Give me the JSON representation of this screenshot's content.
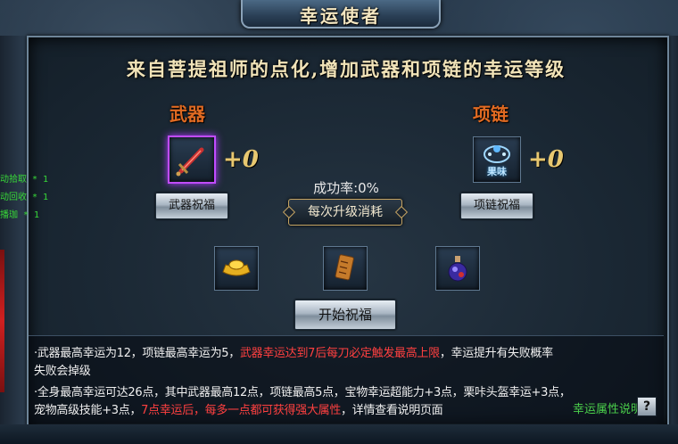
{
  "window": {
    "title": "幸运使者"
  },
  "headline": "来自菩提祖师的点化,增加武器和项链的幸运等级",
  "weapon": {
    "title": "武器",
    "level": "+0",
    "button": "武器祝福"
  },
  "necklace": {
    "title": "项链",
    "level": "+0",
    "button": "项链祝福",
    "icon_text": "果味"
  },
  "success_rate": "成功率:0%",
  "consume_label": "每次升级消耗",
  "start_button": "开始祝福",
  "side_log": [
    {
      "text": "动拾取 * 1"
    },
    {
      "text": "动回收 * 1"
    },
    {
      "text": "播珈 * 1"
    }
  ],
  "info": {
    "line1_a": "·武器最高幸运为12，项链最高幸运为5，",
    "line1_b": "武器幸运达到7后每刀必定触发最高上限",
    "line1_c": "，幸运提升有失败概率",
    "line2": "失败会掉级",
    "line3": "·全身最高幸运可达26点，其中武器最高12点，项链最高5点，宝物幸运超能力+3点，栗咔头盔幸运+3点，",
    "line4_a": "宠物高级技能+3点，",
    "line4_b": "7点幸运后，每多一点都可获得强大属性",
    "line4_c": "，详情查看说明页面",
    "link": "幸运属性说明",
    "help": "?"
  },
  "colors": {
    "accent_red": "#ff4040",
    "link_green": "#4bd04b",
    "section_orange": "#e06a22"
  }
}
